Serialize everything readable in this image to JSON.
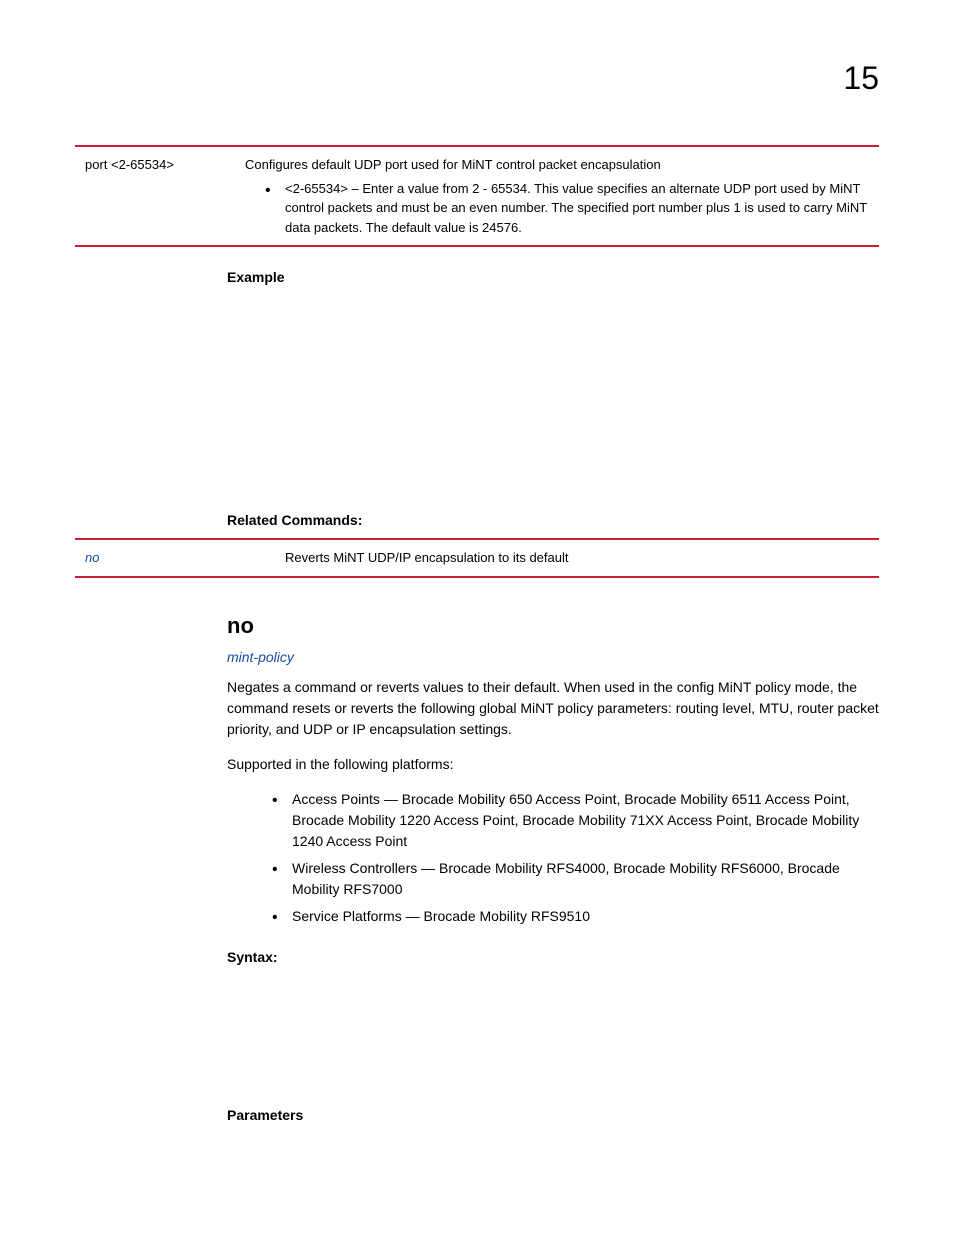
{
  "page_number": "15",
  "param_table": {
    "left": "port <2-65534>",
    "description_lead": "Configures default UDP port used for MiNT control packet encapsulation",
    "bullet": "<2-65534> – Enter a value from 2 - 65534. This value specifies an alternate UDP port used by MiNT control packets and must be an even number. The specified port number plus 1 is used to carry MiNT data packets. The default value is 24576."
  },
  "example_label": "Example",
  "related_commands_label": "Related Commands:",
  "related_table": {
    "left": "no",
    "right": "Reverts MiNT UDP/IP encapsulation to its default"
  },
  "no_section": {
    "heading": "no",
    "subheading": "mint-policy",
    "paragraph1": "Negates a command or reverts values to their default. When used in the config MiNT policy mode, the      command resets or reverts the following global MiNT policy parameters: routing level, MTU, router packet priority, and UDP or IP encapsulation settings.",
    "supported_label": "Supported in the following platforms:",
    "platforms": [
      "Access Points — Brocade Mobility 650 Access Point, Brocade Mobility 6511 Access Point, Brocade Mobility 1220 Access Point, Brocade Mobility 71XX Access Point, Brocade Mobility 1240 Access Point",
      "Wireless Controllers — Brocade Mobility RFS4000, Brocade Mobility RFS6000, Brocade Mobility RFS7000",
      "Service Platforms — Brocade Mobility RFS9510"
    ],
    "syntax_label": "Syntax:",
    "parameters_label": "Parameters"
  }
}
